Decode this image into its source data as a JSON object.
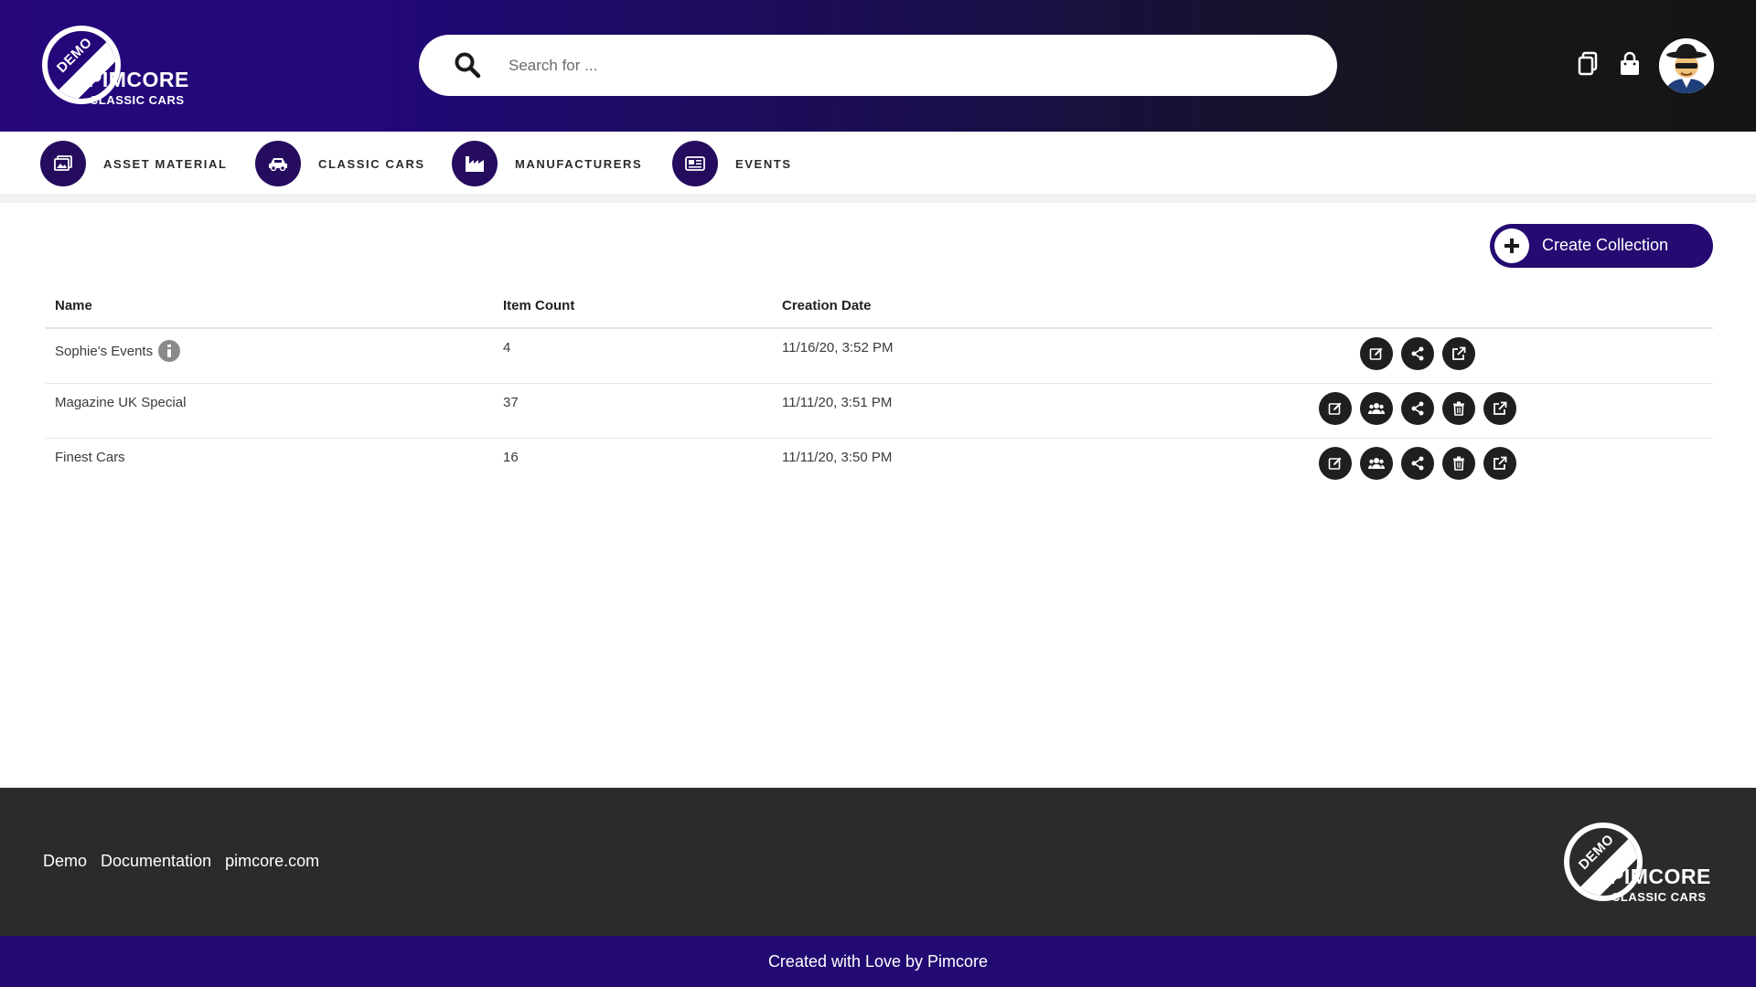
{
  "logo": {
    "demo": "DEMO",
    "word": "PIMCORE",
    "sub": "CLASSIC CARS"
  },
  "search": {
    "placeholder": "Search for ..."
  },
  "header": {
    "icons": [
      "collection-icon",
      "bag-icon"
    ],
    "avatar": "user-avatar"
  },
  "nav": {
    "items": [
      {
        "label": "ASSET MATERIAL",
        "icon": "images-icon"
      },
      {
        "label": "CLASSIC CARS",
        "icon": "car-icon"
      },
      {
        "label": "MANUFACTURERS",
        "icon": "factory-icon"
      },
      {
        "label": "EVENTS",
        "icon": "newspaper-icon"
      }
    ]
  },
  "main": {
    "create_label": "Create Collection",
    "table": {
      "headers": {
        "name": "Name",
        "count": "Item Count",
        "date": "Creation Date"
      },
      "rows": [
        {
          "name": "Sophie's Events",
          "count": "4",
          "date": "11/16/20, 3:52 PM",
          "info": true,
          "actions": [
            "edit-icon",
            "share-icon",
            "open-external-icon"
          ]
        },
        {
          "name": "Magazine UK Special",
          "count": "37",
          "date": "11/11/20, 3:51 PM",
          "info": false,
          "actions": [
            "edit-icon",
            "users-icon",
            "share-icon",
            "trash-icon",
            "open-external-icon"
          ]
        },
        {
          "name": "Finest Cars",
          "count": "16",
          "date": "11/11/20, 3:50 PM",
          "info": false,
          "actions": [
            "edit-icon",
            "users-icon",
            "share-icon",
            "trash-icon",
            "open-external-icon"
          ]
        }
      ]
    }
  },
  "footer": {
    "links": [
      "Demo",
      "Documentation",
      "pimcore.com"
    ],
    "credit": "Created with Love by Pimcore"
  },
  "colors": {
    "brand_purple": "#250a72",
    "header_dark": "#151515",
    "footer_dark": "#2b2b2b",
    "action_dark": "#1f1f1f"
  }
}
